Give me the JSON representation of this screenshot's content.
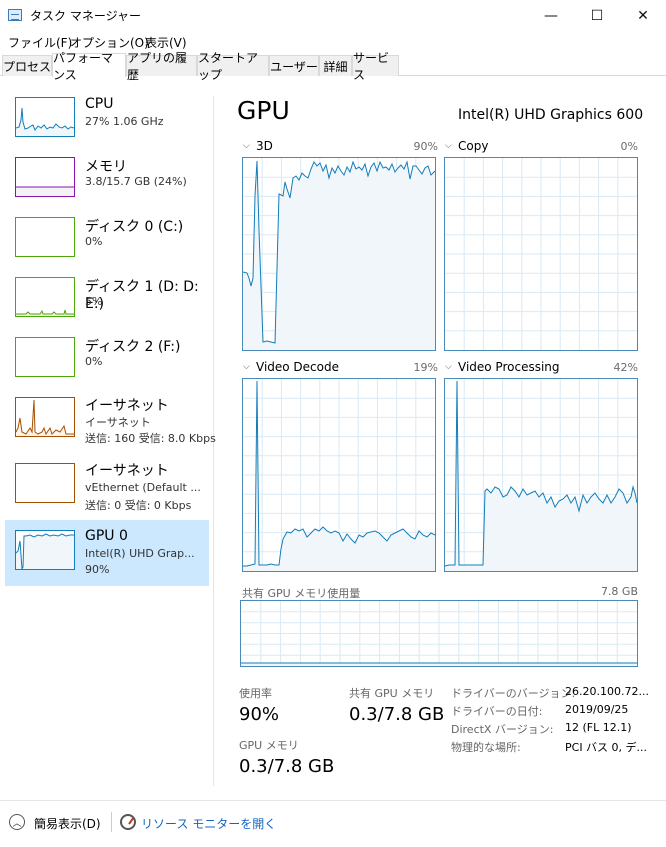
{
  "window": {
    "title": "タスク マネージャー",
    "minimize_glyph": "—",
    "maximize_glyph": "☐",
    "close_glyph": "✕"
  },
  "menu": [
    "ファイル(F)",
    "オプション(O)",
    "表示(V)"
  ],
  "tabs": [
    "プロセス",
    "パフォーマンス",
    "アプリの履歴",
    "スタートアップ",
    "ユーザー",
    "詳細",
    "サービス"
  ],
  "active_tab": "パフォーマンス",
  "sidebar": {
    "items": [
      {
        "title": "CPU",
        "sub1": "27%  1.06 GHz",
        "sub2": "",
        "color": "#117dbb",
        "fill": "#f1f6fa"
      },
      {
        "title": "メモリ",
        "sub1": "3.8/15.7 GB (24%)",
        "sub2": "",
        "color": "#8b12ae",
        "fill": "#f4f2f4"
      },
      {
        "title": "ディスク 0 (C:)",
        "sub1": "0%",
        "sub2": "",
        "color": "#4da60c",
        "fill": "#eff7ea"
      },
      {
        "title": "ディスク 1 (D: D: E:)",
        "sub1": "5%",
        "sub2": "",
        "color": "#4da60c",
        "fill": "#eff7ea"
      },
      {
        "title": "ディスク 2 (F:)",
        "sub1": "0%",
        "sub2": "",
        "color": "#4da60c",
        "fill": "#eff7ea"
      },
      {
        "title": "イーサネット",
        "sub1": "イーサネット",
        "sub2": "送信: 160  受信: 8.0 Kbps",
        "color": "#a74f01",
        "fill": "#fcf3eb"
      },
      {
        "title": "イーサネット",
        "sub1": "vEthernet (Default ...",
        "sub2": "送信: 0  受信: 0 Kbps",
        "color": "#a74f01",
        "fill": "#fcf3eb"
      },
      {
        "title": "GPU 0",
        "sub1": "Intel(R) UHD Grap...",
        "sub2": "90%",
        "color": "#117dbb",
        "fill": "#f1f6fa"
      }
    ]
  },
  "main": {
    "heading": "GPU",
    "model": "Intel(R) UHD Graphics 600",
    "graphs": [
      {
        "label": "3D",
        "percent": "90%"
      },
      {
        "label": "Copy",
        "percent": "0%"
      },
      {
        "label": "Video Decode",
        "percent": "19%"
      },
      {
        "label": "Video Processing",
        "percent": "42%"
      }
    ],
    "shared_memory": {
      "label": "共有 GPU メモリ使用量",
      "max": "7.8 GB"
    },
    "stats": {
      "usage_label": "使用率",
      "usage_value": "90%",
      "shared_label": "共有 GPU メモリ",
      "shared_value": "0.3/7.8 GB",
      "gpu_mem_label": "GPU メモリ",
      "gpu_mem_value": "0.3/7.8 GB"
    },
    "info": [
      {
        "label": "ドライバーのバージョン:",
        "value": "26.20.100.72..."
      },
      {
        "label": "ドライバーの日付:",
        "value": "2019/09/25"
      },
      {
        "label": "DirectX バージョン:",
        "value": "12 (FL 12.1)"
      },
      {
        "label": "物理的な場所:",
        "value": "PCI バス 0, デ..."
      }
    ]
  },
  "footer": {
    "fewer_details": "簡易表示(D)",
    "resource_monitor": "リソース モニターを開く"
  },
  "colors": {
    "graph_line": "#117dbb",
    "graph_fill": "#f1f6fa",
    "graph_grid": "#d9eaf4",
    "selection": "#cce8ff"
  }
}
